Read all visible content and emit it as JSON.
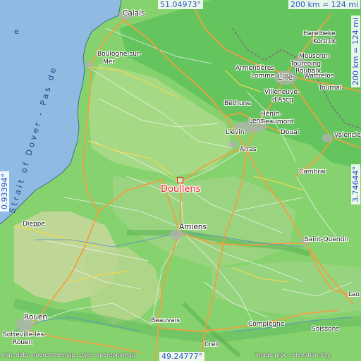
{
  "map": {
    "focus_city": "Doullens",
    "cities": {
      "calais": "Calais",
      "boulogne_1": "Boulogne-sur-",
      "boulogne_2": "Mer",
      "armentieres": "Armentières",
      "lille": "Lille",
      "lomme": "Lomme",
      "harelbeke": "Harelbeke",
      "kortrijk": "Kortrijk",
      "mouscron": "Mouscron",
      "tourcoing": "Tourcoing",
      "roubaix": "Roubaix",
      "wattrelos": "Wattrelos",
      "tournai": "Tournai",
      "villeneuve_1": "Villeneuve-",
      "villeneuve_2": "d'Ascq",
      "bethune": "Béthune",
      "henin_1": "Hénin-",
      "henin_2": "Beaumont",
      "lens": "Lens",
      "lievin": "Liévin",
      "douai": "Douai",
      "valenciennes": "Valencie",
      "arras": "Arras",
      "cambrai": "Cambrai",
      "amiens": "Amiens",
      "saint_quentin": "Saint-Quentin",
      "dieppe": "Dieppe",
      "rouen": "Rouen",
      "sotteville_1": "Sotteville-lès-",
      "sotteville_2": "Rouen",
      "beauvais": "Beauvais",
      "compiegne": "Compiègne",
      "soissons": "Soissons",
      "laon": "Lao",
      "creil": "Creil"
    },
    "sea_label": "Strait of Dover - Pas de",
    "sea_label_left": "e",
    "coords": {
      "top": "51.04973°",
      "bottom": "49.24777°",
      "left": "0.93394°",
      "right": "3.74644°"
    },
    "scale": "200 km = 124 mi",
    "credit_left": "map data: openstreetmap, style: opentopomap",
    "credit_right": "image proc.: elevation.city",
    "colors": {
      "sea": "#8fbbe2",
      "lowland": "#7fd06a",
      "midland": "#a8d987",
      "highland": "#c5d79a",
      "motorway": "#f0a040",
      "focus": "#e32020",
      "coord_text": "#2b57c8"
    }
  }
}
